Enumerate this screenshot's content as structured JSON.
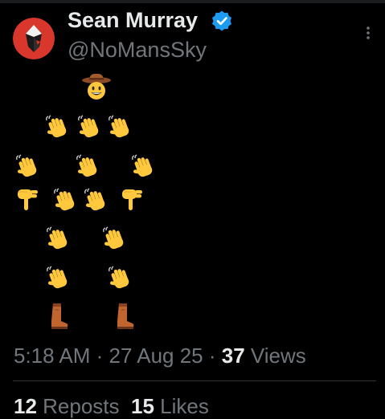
{
  "author": {
    "display_name": "Sean Murray",
    "handle": "@NoMansSky",
    "verified": true
  },
  "tweet": {
    "emoji_art": [
      {
        "icon": "cowboy-hat-face-icon"
      },
      {
        "icon": "waving-hand-icon"
      },
      {
        "icon": "waving-hand-icon"
      },
      {
        "icon": "waving-hand-icon"
      },
      {
        "icon": "waving-hand-icon"
      },
      {
        "icon": "waving-hand-icon"
      },
      {
        "icon": "waving-hand-icon"
      },
      {
        "icon": "pointing-down-hand-icon"
      },
      {
        "icon": "waving-hand-icon"
      },
      {
        "icon": "waving-hand-icon"
      },
      {
        "icon": "pointing-down-hand-icon"
      },
      {
        "icon": "waving-hand-icon"
      },
      {
        "icon": "waving-hand-icon"
      },
      {
        "icon": "waving-hand-icon"
      },
      {
        "icon": "waving-hand-icon"
      },
      {
        "icon": "boot-icon"
      },
      {
        "icon": "boot-icon"
      }
    ]
  },
  "meta": {
    "time": "5:18 AM",
    "separator": " · ",
    "date": "27 Aug 25",
    "views_count": "37",
    "views_label": " Views"
  },
  "stats": {
    "reposts_count": "12",
    "reposts_label": " Reposts",
    "likes_count": "15",
    "likes_label": " Likes"
  },
  "colors": {
    "background": "#000000",
    "primary_text": "#e7e9ea",
    "secondary_text": "#71767b",
    "verified_blue": "#1d9bf0",
    "avatar_red": "#d9372c",
    "emoji_yellow": "#ffc83d",
    "boot_brown": "#c0652f"
  }
}
